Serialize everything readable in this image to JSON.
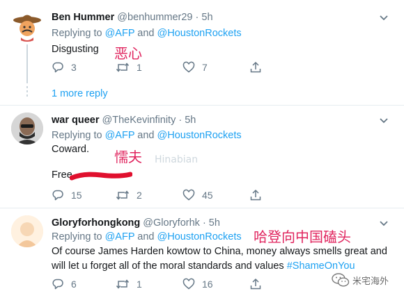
{
  "colors": {
    "link": "#1da1f2",
    "muted": "#657786",
    "annotation": "#e0245e",
    "redaction": "#e0102e"
  },
  "tweets": [
    {
      "name": "Ben Hummer",
      "handle": "@benhummer29",
      "time": "· 5h",
      "replying_prefix": "Replying to",
      "mention1": "@AFP",
      "and": "and",
      "mention2": "@HoustonRockets",
      "text": "Disgusting",
      "annotation": "恶心",
      "replies": "3",
      "retweets": "1",
      "likes": "7",
      "icons": [
        "reply-icon",
        "retweet-icon",
        "like-icon",
        "share-icon"
      ]
    },
    {
      "name": "war queer",
      "handle": "@TheKevinfinity",
      "time": "· 5h",
      "replying_prefix": "Replying to",
      "mention1": "@AFP",
      "and": "and",
      "mention2": "@HoustonRockets",
      "text": "Coward.",
      "text2": "Free",
      "annotation": "懦夫",
      "replies": "15",
      "retweets": "2",
      "likes": "45",
      "icons": [
        "reply-icon",
        "retweet-icon",
        "like-icon",
        "share-icon"
      ]
    },
    {
      "name": "Gloryforhongkong",
      "handle": "@Gloryforhk",
      "time": "· 5h",
      "replying_prefix": "Replying to",
      "mention1": "@AFP",
      "and": "and",
      "mention2": "@HoustonRockets",
      "text_line1": "Of course James Harden kowtow to China, money always smells great and",
      "text_line2": "will let u forget all of the moral standards and values",
      "hashtag": "#ShameOnYou",
      "annotation": "哈登向中国磕头",
      "replies": "6",
      "retweets": "1",
      "likes": "16",
      "icons": [
        "reply-icon",
        "retweet-icon",
        "like-icon",
        "share-icon"
      ]
    }
  ],
  "more_replies": "1 more reply",
  "watermark": "米宅海外",
  "faint_watermark": "Hinabian"
}
